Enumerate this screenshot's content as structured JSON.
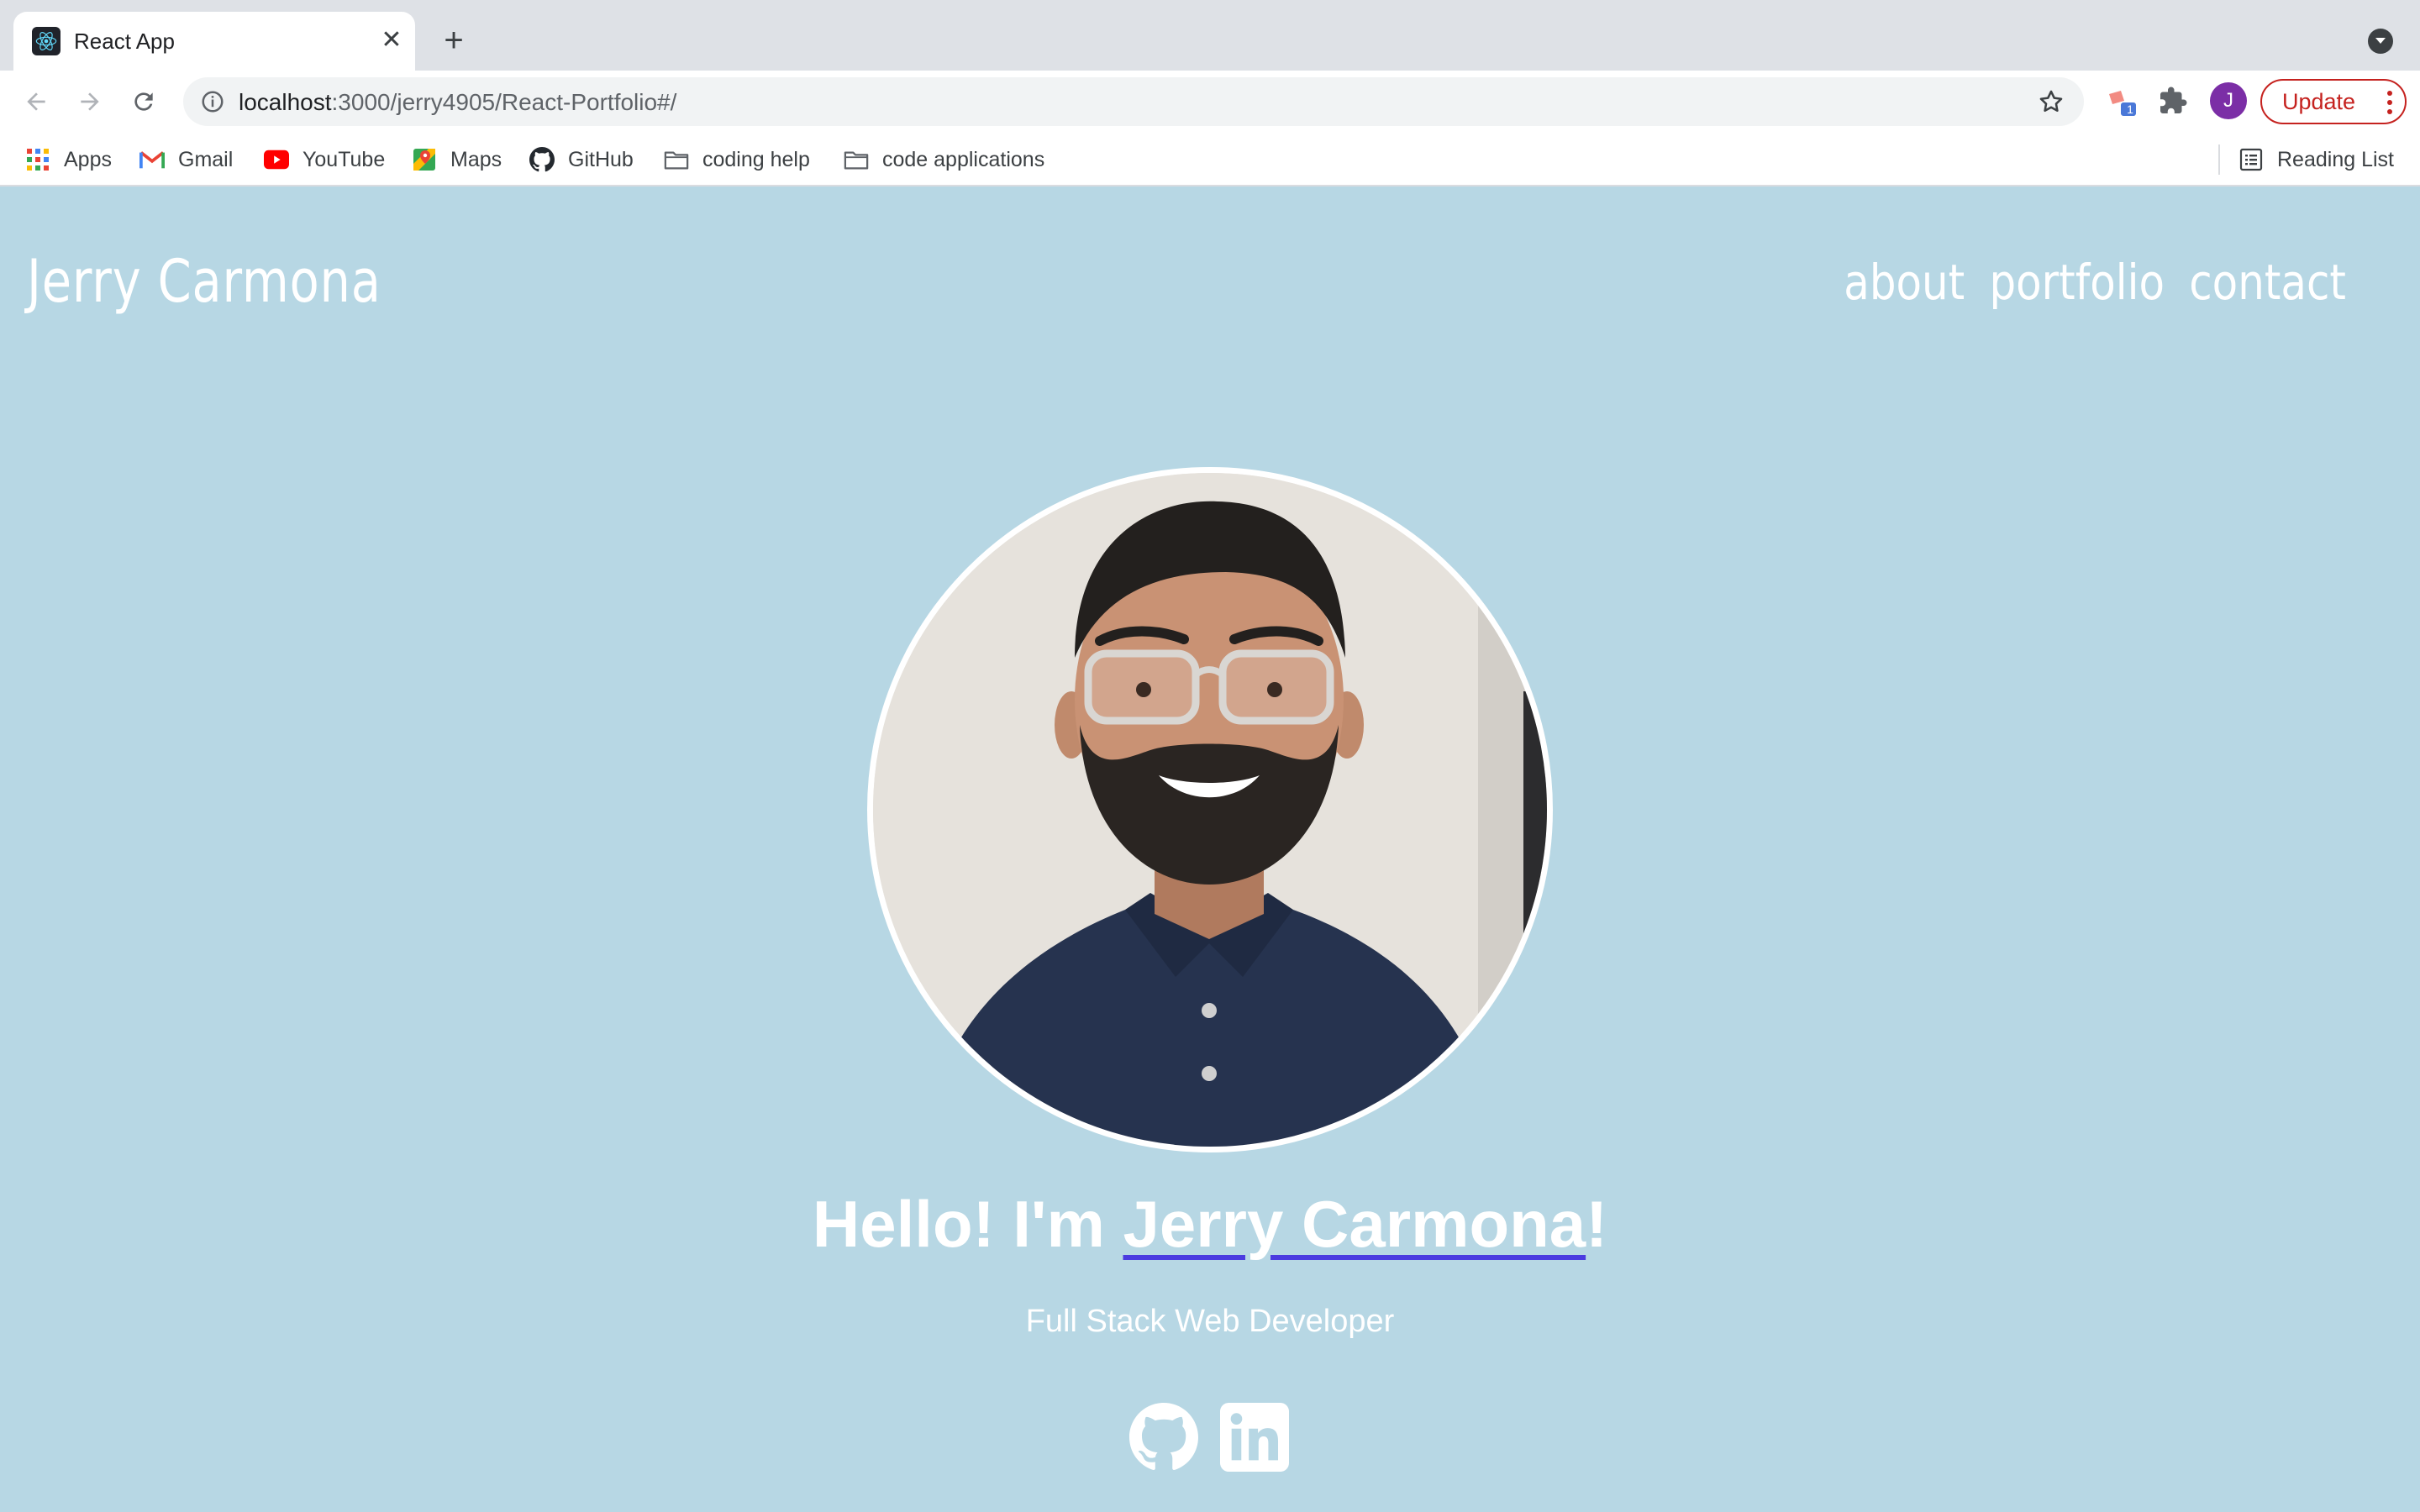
{
  "browser": {
    "tab_title": "React App",
    "tab_close": "✕",
    "new_tab": "+",
    "url_host": "localhost",
    "url_rest": ":3000/jerry4905/React-Portfolio#/",
    "extension_badge": "1",
    "profile_initial": "J",
    "update_label": "Update",
    "accent_color": "#c5221f"
  },
  "bookmarks": {
    "items": [
      {
        "label": "Apps",
        "icon": "apps-grid-icon"
      },
      {
        "label": "Gmail",
        "icon": "gmail-icon"
      },
      {
        "label": "YouTube",
        "icon": "youtube-icon"
      },
      {
        "label": "Maps",
        "icon": "maps-icon"
      },
      {
        "label": "GitHub",
        "icon": "github-icon"
      },
      {
        "label": "coding help",
        "icon": "folder-icon"
      },
      {
        "label": "code applications",
        "icon": "folder-icon"
      }
    ],
    "reading_list": "Reading List"
  },
  "site": {
    "title": "Jerry Carmona",
    "nav": {
      "about": "about",
      "portfolio": "portfolio",
      "contact": "contact"
    },
    "hero": {
      "greeting_prefix": "Hello! I'm ",
      "name": "Jerry Carmona",
      "greeting_suffix": "!",
      "subtitle": "Full Stack Web Developer"
    },
    "social": [
      "github-icon",
      "linkedin-icon"
    ],
    "background_color": "#b7d7e4",
    "underline_color": "#4b3be0"
  }
}
